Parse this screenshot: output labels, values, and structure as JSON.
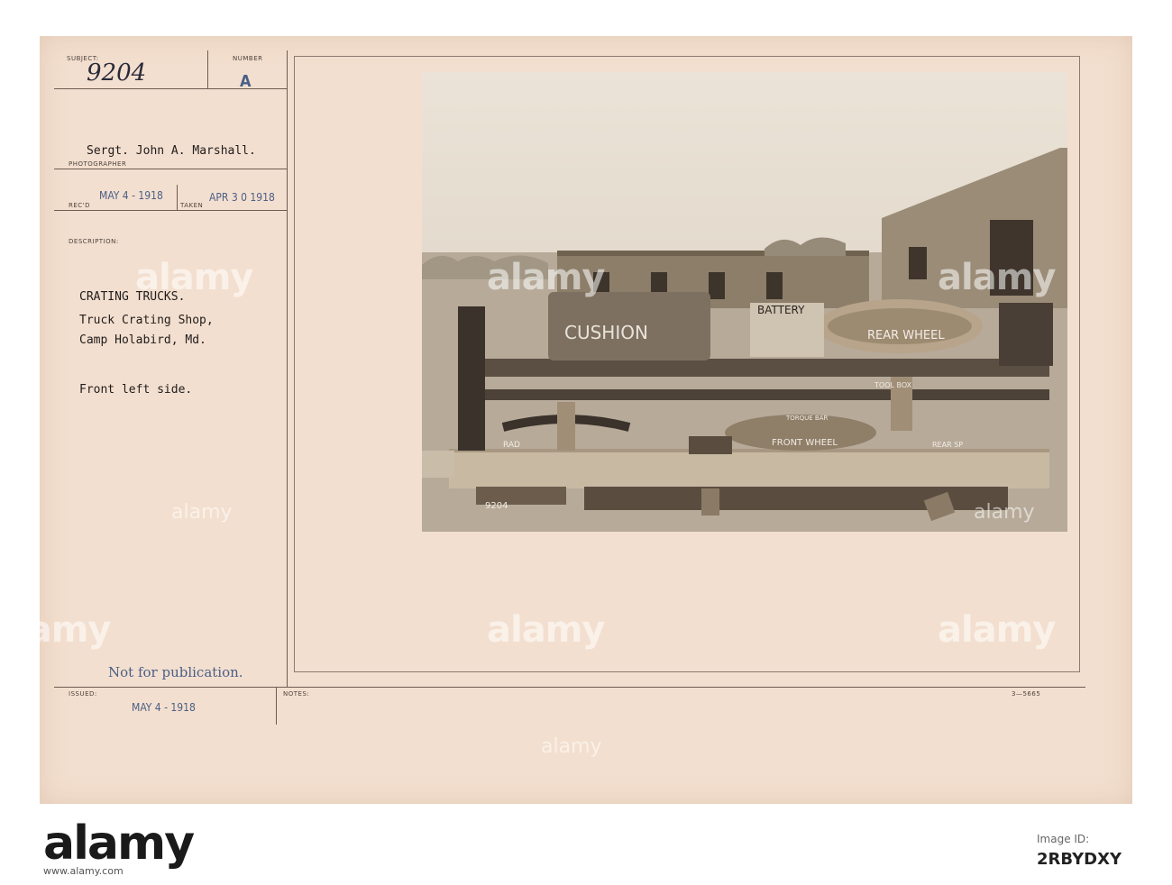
{
  "card": {
    "subject_label": "SUBJECT:",
    "number_label": "NUMBER",
    "subject_value": "9204",
    "number_value": "A",
    "photographer_name": "Sergt. John A. Marshall.",
    "photographer_label": "PHOTOGRAPHER",
    "recd_label": "REC'D",
    "recd_date": "MAY 4 - 1918",
    "taken_label": "TAKEN",
    "taken_date": "APR 3 0 1918",
    "description_label": "DESCRIPTION:",
    "description_title": "CRATING TRUCKS.",
    "description_line1": "Truck Crating Shop,",
    "description_line2": "Camp Holabird, Md.",
    "description_line3": "Front left side.",
    "not_for_publication": "Not for publication.",
    "issued_label": "ISSUED:",
    "issued_date": "MAY 4 - 1918",
    "notes_label": "NOTES:",
    "form_number": "3—5665"
  },
  "photo": {
    "chalk_labels": {
      "cushion": "CUSHION",
      "battery": "BATTERY",
      "rear_wheel": "REAR WHEEL",
      "tool_box": "TOOL BOX",
      "torque_bar": "TORQUE BAR",
      "front_wheel": "FRONT WHEEL",
      "rad": "RAD",
      "rear_sp": "REAR SP",
      "negative_number": "9204"
    }
  },
  "watermark": {
    "brand": "alamy"
  },
  "banner": {
    "brand": "alamy",
    "image_id_label": "Image ID:",
    "image_id": "2RBYDXY",
    "url": "www.alamy.com"
  }
}
